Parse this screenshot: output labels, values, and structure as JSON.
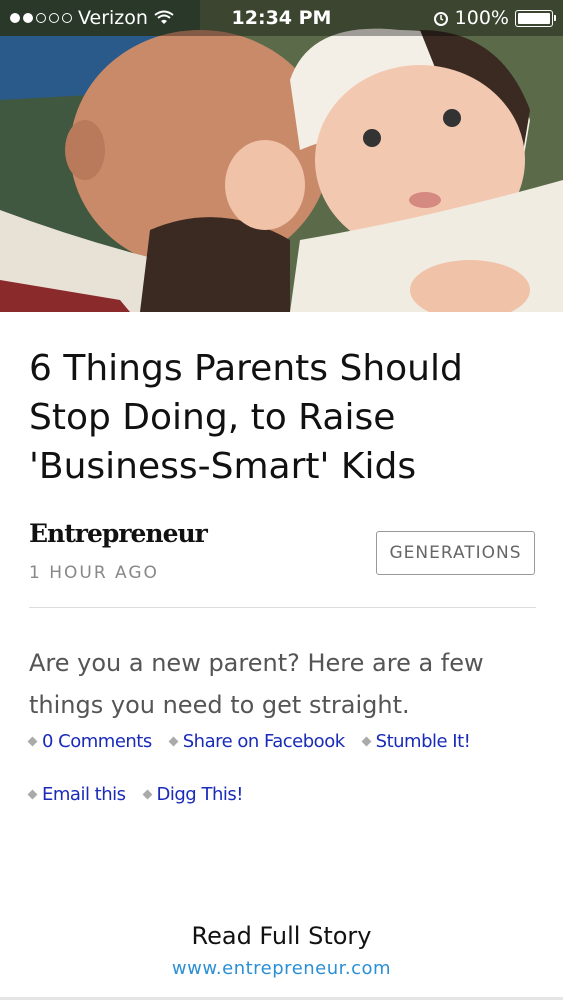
{
  "status_bar": {
    "carrier": "Verizon",
    "time": "12:34 PM",
    "battery": "100%",
    "signal_dots_filled": 2,
    "signal_dots_total": 5
  },
  "article": {
    "image_alt": "",
    "title": "6 Things Parents Should Stop Doing, to Raise 'Business-Smart' Kids",
    "source": "Entrepreneur",
    "time_ago": "1 HOUR AGO",
    "tag": "GENERATIONS",
    "summary": "Are you a new parent? Here are a few things you need to get straight."
  },
  "share_links": [
    {
      "label": "0 Comments"
    },
    {
      "label": "Share on Facebook"
    },
    {
      "label": "Stumble It!"
    },
    {
      "label": "Email this"
    },
    {
      "label": "Digg This!"
    }
  ],
  "footer": {
    "read_full": "Read Full Story",
    "url": "www.entrepreneur.com"
  },
  "colors": {
    "link": "#1a2bb8",
    "url": "#2b8fd6",
    "title": "#111111",
    "muted": "#888888"
  }
}
